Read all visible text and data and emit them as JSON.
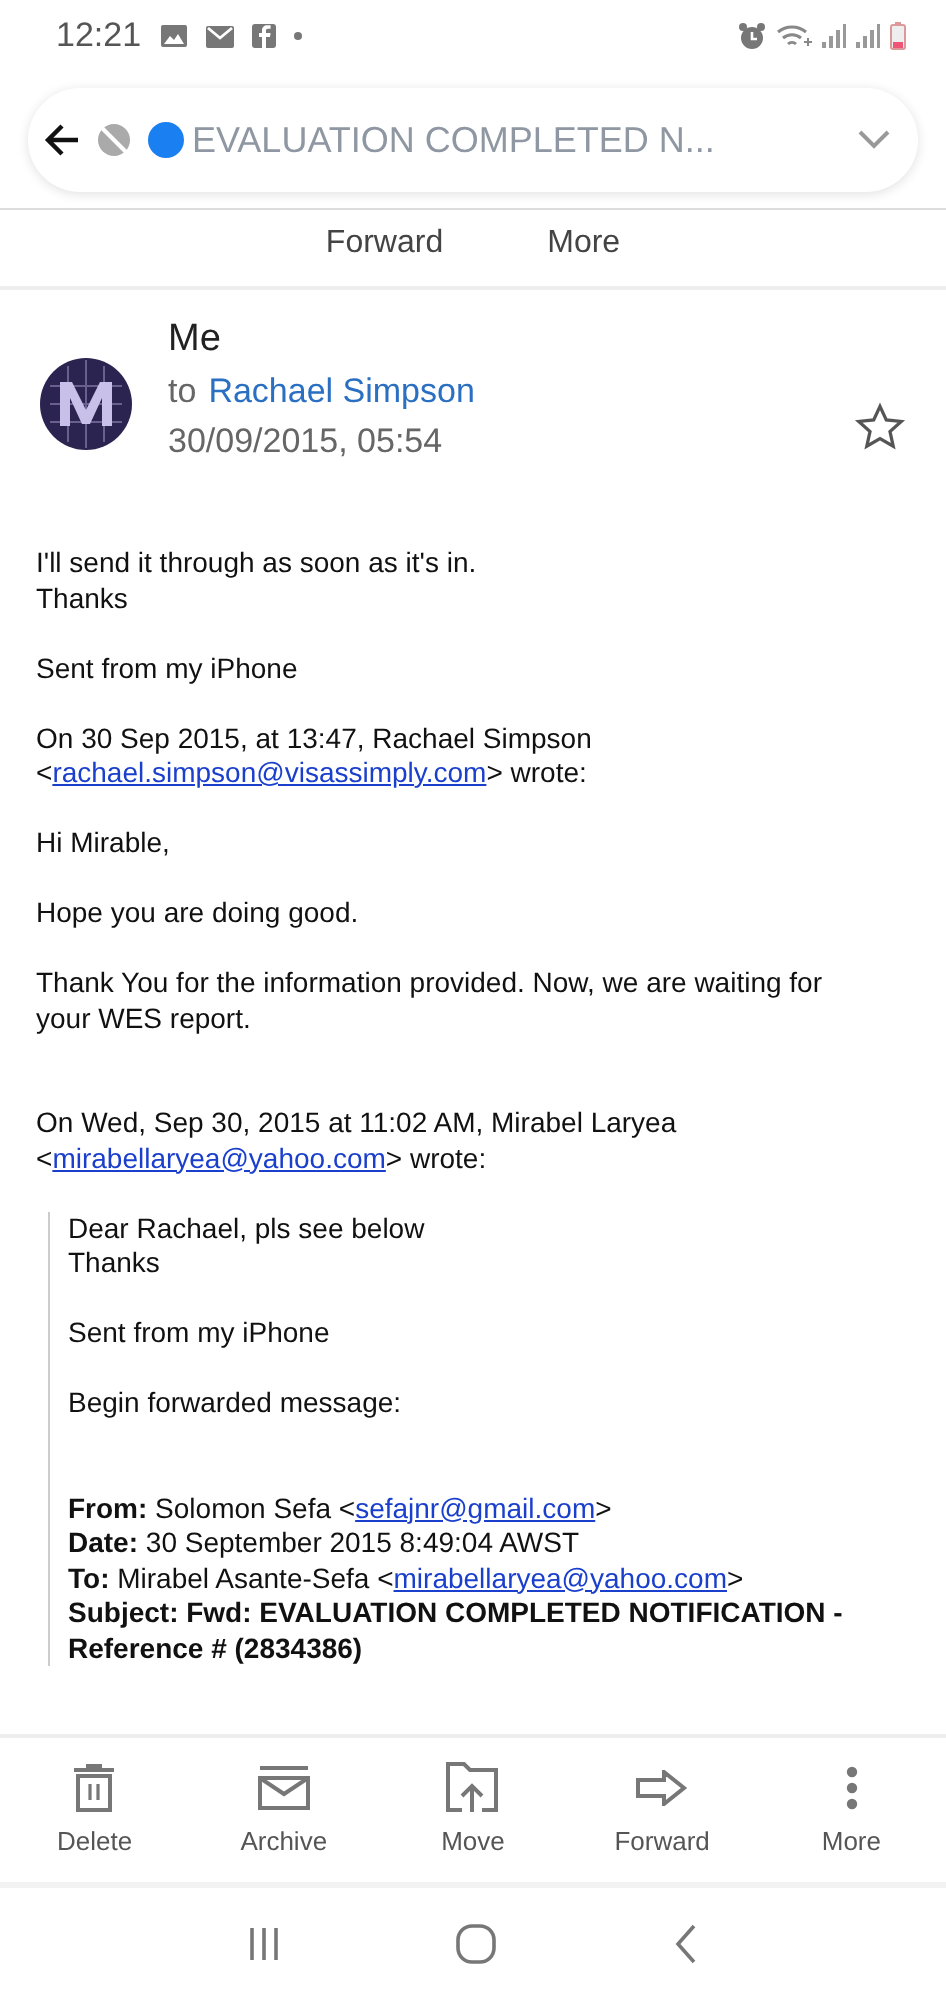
{
  "status_bar": {
    "time": "12:21"
  },
  "header": {
    "subject": "EVALUATION COMPLETED N...",
    "actions": [
      "Forward",
      "More"
    ]
  },
  "message": {
    "sender": "Me",
    "to_prefix": "to",
    "recipient": "Rachael Simpson",
    "date": "30/09/2015, 05:54",
    "starred": false,
    "body": [
      {
        "kind": "para",
        "lines": [
          [
            {
              "text": "I'll send it through as soon as it's in."
            }
          ],
          [
            {
              "text": "Thanks"
            }
          ]
        ]
      },
      {
        "kind": "para",
        "lines": [
          [
            {
              "text": "Sent from my iPhone"
            }
          ]
        ]
      },
      {
        "kind": "para",
        "lines": [
          [
            {
              "text": "On 30 Sep 2015, at 13:47, Rachael Simpson"
            }
          ],
          [
            {
              "text": "<"
            },
            {
              "text": "rachael.simpson@visassimply.com",
              "kind": "link"
            },
            {
              "text": "> wrote:"
            }
          ]
        ]
      },
      {
        "kind": "para",
        "lines": [
          [
            {
              "text": "Hi Mirable,"
            }
          ]
        ]
      },
      {
        "kind": "para",
        "lines": [
          [
            {
              "text": "Hope you are doing good."
            }
          ]
        ]
      },
      {
        "kind": "para",
        "lines": [
          [
            {
              "text": "Thank You for the information provided. Now, we are waiting for"
            }
          ],
          [
            {
              "text": "your WES report."
            }
          ]
        ]
      },
      {
        "kind": "gap"
      },
      {
        "kind": "para",
        "lines": [
          [
            {
              "text": "On Wed, Sep 30, 2015 at 11:02 AM, Mirabel Laryea"
            }
          ],
          [
            {
              "text": "<"
            },
            {
              "text": "mirabellaryea@yahoo.com",
              "kind": "link"
            },
            {
              "text": "> wrote:"
            }
          ]
        ]
      },
      {
        "kind": "quote",
        "children": [
          {
            "kind": "para",
            "lines": [
              [
                {
                  "text": "Dear Rachael, pls see below"
                }
              ],
              [
                {
                  "text": "Thanks"
                }
              ]
            ]
          },
          {
            "kind": "para",
            "lines": [
              [
                {
                  "text": "Sent from my iPhone"
                }
              ]
            ]
          },
          {
            "kind": "para",
            "lines": [
              [
                {
                  "text": "Begin forwarded message:"
                }
              ]
            ]
          },
          {
            "kind": "gap"
          },
          {
            "kind": "para",
            "lines": [
              [
                {
                  "text": "**From:** Solomon Sefa <"
                },
                {
                  "text": "sefajnr@gmail.com",
                  "kind": "link"
                },
                {
                  "text": ">"
                }
              ],
              [
                {
                  "text": "**Date:** 30 September 2015 8:49:04 AWST"
                }
              ],
              [
                {
                  "text": "**To:** Mirabel Asante-Sefa <"
                },
                {
                  "text": "mirabellaryea@yahoo.com",
                  "kind": "link"
                },
                {
                  "text": ">"
                }
              ],
              [
                {
                  "text": "**Subject: Fwd: EVALUATION COMPLETED NOTIFICATION -**"
                }
              ],
              [
                {
                  "text": "**Reference # (2834386)**"
                }
              ]
            ]
          }
        ]
      }
    ]
  },
  "toolbar": [
    {
      "kind": "delete",
      "label": "Delete"
    },
    {
      "kind": "archive",
      "label": "Archive"
    },
    {
      "kind": "move",
      "label": "Move"
    },
    {
      "kind": "forward",
      "label": "Forward"
    },
    {
      "kind": "more",
      "label": "More"
    }
  ]
}
